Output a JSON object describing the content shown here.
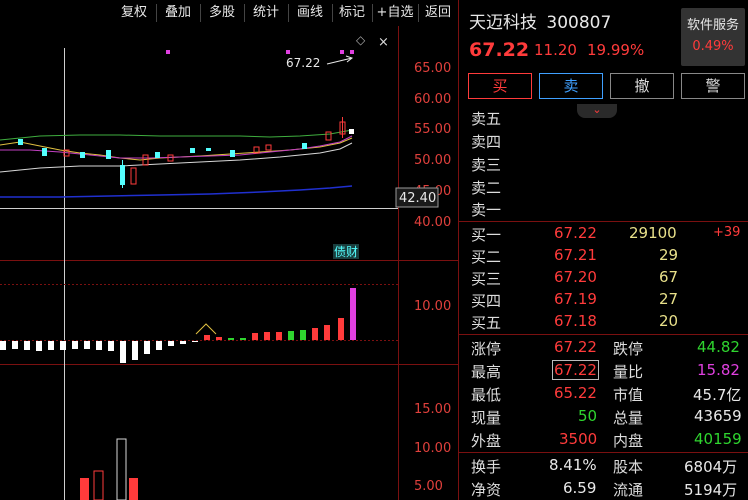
{
  "toolbar": {
    "buttons": [
      "复权",
      "叠加",
      "多股",
      "统计",
      "画线",
      "标记",
      "+自选",
      "返回"
    ]
  },
  "chart": {
    "price_axis": [
      "65.00",
      "60.00",
      "55.00",
      "50.00",
      "45.00",
      "40.00"
    ],
    "crosshair_price": "42.40",
    "high_annotation": "67.22",
    "finance_tag": "债财",
    "macd_axis": [
      "10.00"
    ],
    "volume_axis": [
      "15.00",
      "10.00",
      "5.00"
    ]
  },
  "stock": {
    "name": "天迈科技",
    "code": "300807",
    "price": "67.22",
    "change": "11.20",
    "change_pct": "19.99%"
  },
  "service": {
    "label": "软件服务",
    "pct": "0.49%"
  },
  "trade_buttons": [
    "买",
    "卖",
    "撤",
    "警"
  ],
  "sell_levels": [
    {
      "label": "卖五",
      "price": "",
      "vol": ""
    },
    {
      "label": "卖四",
      "price": "",
      "vol": ""
    },
    {
      "label": "卖三",
      "price": "",
      "vol": ""
    },
    {
      "label": "卖二",
      "price": "",
      "vol": ""
    },
    {
      "label": "卖一",
      "price": "",
      "vol": ""
    }
  ],
  "buy_levels": [
    {
      "label": "买一",
      "price": "67.22",
      "vol": "29100",
      "delta": "+39"
    },
    {
      "label": "买二",
      "price": "67.21",
      "vol": "29",
      "delta": ""
    },
    {
      "label": "买三",
      "price": "67.20",
      "vol": "67",
      "delta": ""
    },
    {
      "label": "买四",
      "price": "67.19",
      "vol": "27",
      "delta": ""
    },
    {
      "label": "买五",
      "price": "67.18",
      "vol": "20",
      "delta": ""
    }
  ],
  "stats": [
    {
      "l1": "涨停",
      "v1": "67.22",
      "l2": "跌停",
      "v2": "44.82"
    },
    {
      "l1": "最高",
      "v1": "67.22",
      "l2": "量比",
      "v2": "15.82"
    },
    {
      "l1": "最低",
      "v1": "65.22",
      "l2": "市值",
      "v2": "45.7亿"
    },
    {
      "l1": "现量",
      "v1": "50",
      "l2": "总量",
      "v2": "43659"
    },
    {
      "l1": "外盘",
      "v1": "3500",
      "l2": "内盘",
      "v2": "40159"
    },
    {
      "l1": "换手",
      "v1": "8.41%",
      "l2": "股本",
      "v2": "6804万"
    },
    {
      "l1": "净资",
      "v1": "6.59",
      "l2": "流通",
      "v2": "5194万"
    }
  ],
  "colors": {
    "up": "#ff3b3b",
    "down": "#54ffff",
    "border": "#7a1010",
    "bg": "#000000"
  }
}
